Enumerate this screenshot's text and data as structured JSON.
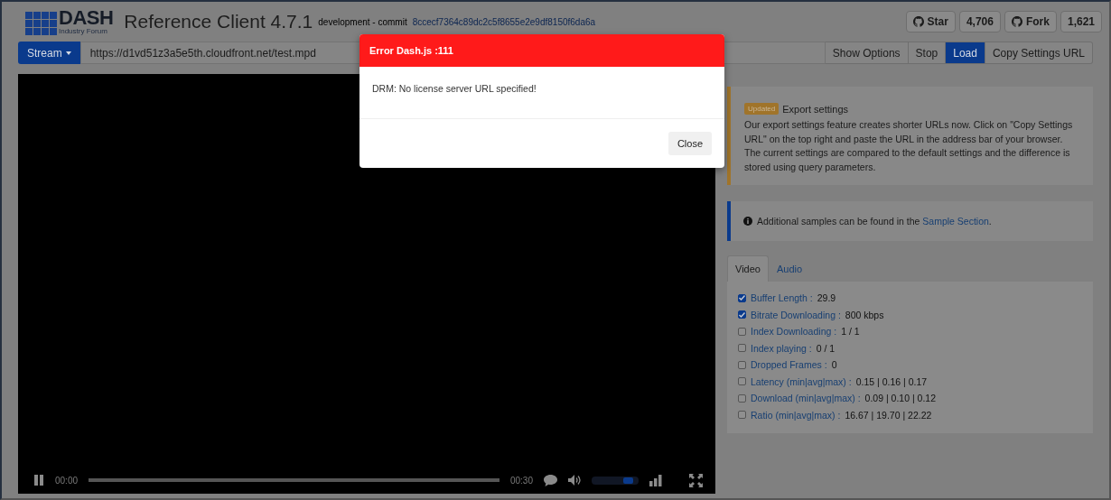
{
  "header": {
    "logo_title": "DASH",
    "logo_subtitle": "Industry Forum",
    "title": "Reference Client 4.7.1",
    "build": "development - commit",
    "commit": "8ccecf7364c89dc2c5f8655e2e9df8150f6da6a",
    "github": [
      {
        "label": "Star",
        "count": "4,706"
      },
      {
        "label": "Fork",
        "count": "1,621"
      }
    ]
  },
  "toolbar": {
    "stream_button": "Stream",
    "url": "https://d1vd51z3a5e5th.cloudfront.net/test.mpd",
    "buttons": [
      {
        "label": "Show Options",
        "selected": false
      },
      {
        "label": "Stop",
        "selected": false
      },
      {
        "label": "Load",
        "selected": true
      },
      {
        "label": "Copy Settings URL",
        "selected": false
      }
    ]
  },
  "player": {
    "current_time": "00:00",
    "duration": "00:30",
    "volume": {
      "level": 0.85
    }
  },
  "notice": {
    "badge": "Updated",
    "title": "Export settings",
    "text": "Our export settings feature creates shorter URLs now. Click on \"Copy Settings URL\" on the top right and paste the URL in the address bar of your browser. The current settings are compared to the default settings and the difference is stored using query parameters."
  },
  "info": {
    "text": "Additional samples can be found in the ",
    "link": "Sample Section",
    "after": "."
  },
  "tabs": [
    {
      "label": "Video",
      "selected": true
    },
    {
      "label": "Audio",
      "selected": false
    }
  ],
  "metrics": [
    {
      "label": "Buffer Length :",
      "value": "29.9",
      "checked": true
    },
    {
      "label": "Bitrate Downloading :",
      "value": "800 kbps",
      "checked": true
    },
    {
      "label": "Index Downloading :",
      "value": "1 / 1",
      "checked": false
    },
    {
      "label": "Index playing :",
      "value": "0 / 1",
      "checked": false
    },
    {
      "label": "Dropped Frames :",
      "value": "0",
      "checked": false
    },
    {
      "label": "Latency (min|avg|max) :",
      "value": "0.15 | 0.16 | 0.17",
      "checked": false
    },
    {
      "label": "Download (min|avg|max) :",
      "value": "0.09 | 0.10 | 0.12",
      "checked": false
    },
    {
      "label": "Ratio (min|avg|max) :",
      "value": "16.67 | 19.70 | 22.22",
      "checked": false
    }
  ],
  "dialog": {
    "title": "Error Dash.js :111",
    "message": "DRM: No license server URL specified!",
    "close_button": "Close"
  }
}
